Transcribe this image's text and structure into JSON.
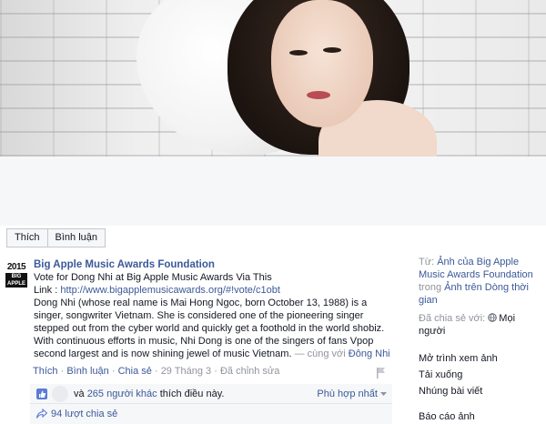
{
  "actions": {
    "like": "Thích",
    "comment": "Bình luận"
  },
  "page": {
    "logo_year": "2015",
    "logo_tag": "BIG APPLE",
    "name": "Big Apple Music Awards Foundation"
  },
  "post": {
    "line1": "Vote for Dong Nhi at Big Apple Music Awards Via This",
    "link_prefix": "Link : ",
    "link_url": "http://www.bigapplemusicawards.org/#!vote/c1obt",
    "body": "Dong Nhi (whose real name is Mai Hong Ngoc, born October 13, 1988) is a singer, songwriter Vietnam. She is considered one of the pioneering singer stepped out from the cyber world and quickly get a foothold in the world shobiz. With continuous efforts in music, Nhi Dong is one of the singers of fans Vpop second largest and is now shining jewel of music Vietnam.",
    "with_prefix": " — cùng với ",
    "with_name": "Đông Nhi"
  },
  "footer": {
    "like": "Thích",
    "comment": "Bình luận",
    "share": "Chia sẻ",
    "date": "29 Tháng 3",
    "edited": "Đã chỉnh sửa",
    "sep": "·"
  },
  "likes": {
    "prefix": "và ",
    "others": "265 người khác",
    "suffix": " thích điều này.",
    "sort": "Phù hợp nhất"
  },
  "shares": {
    "text": "94 lượt chia sẻ"
  },
  "sidebar": {
    "from_label": "Từ: ",
    "album": "Ảnh của Big Apple Music Awards Foundation",
    "in_word": " trong ",
    "timeline": "Ảnh trên Dòng thời gian",
    "shared_with_label": "Đã chia sẻ với: ",
    "shared_with_value": "Mọi người",
    "menu": [
      "Mở trình xem ảnh",
      "Tải xuống",
      "Nhúng bài viết"
    ],
    "report": "Báo cáo ảnh"
  },
  "colors": {
    "link": "#3b5998",
    "muted": "#90949c",
    "band": "#f6f7f9"
  }
}
